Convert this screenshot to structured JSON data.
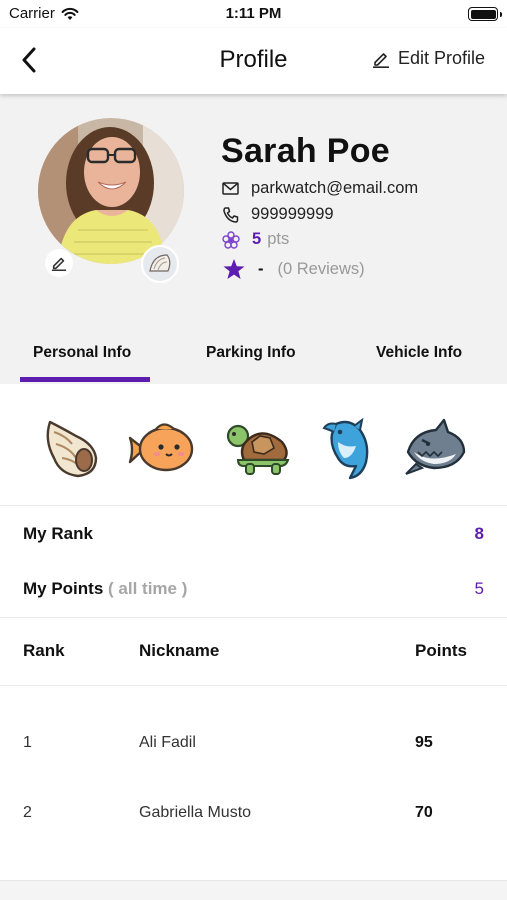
{
  "status_bar": {
    "carrier": "Carrier",
    "time": "1:11 PM"
  },
  "nav": {
    "title": "Profile",
    "edit_label": "Edit Profile"
  },
  "profile": {
    "name": "Sarah Poe",
    "email": "parkwatch@email.com",
    "phone": "999999999",
    "points_value": "5",
    "points_unit": "pts",
    "rating": "-",
    "reviews": "(0 Reviews)"
  },
  "tabs": [
    {
      "label": "Personal Info",
      "active": true
    },
    {
      "label": "Parking Info",
      "active": false
    },
    {
      "label": "Vehicle Info",
      "active": false
    }
  ],
  "creatures": [
    "seashell-icon",
    "fish-icon",
    "turtle-icon",
    "dolphin-icon",
    "shark-icon"
  ],
  "stats": {
    "rank_label": "My Rank",
    "rank_value": "8",
    "points_label": "My Points",
    "points_sub": "( all time )",
    "points_value": "5"
  },
  "leaderboard": {
    "headers": {
      "rank": "Rank",
      "nickname": "Nickname",
      "points": "Points"
    },
    "rows": [
      {
        "rank": "1",
        "nickname": "Ali Fadil",
        "points": "95"
      },
      {
        "rank": "2",
        "nickname": "Gabriella Musto",
        "points": "70"
      }
    ]
  },
  "colors": {
    "accent": "#5d1eb0",
    "header_bg": "#f2f2f2",
    "muted_text": "#999999"
  }
}
